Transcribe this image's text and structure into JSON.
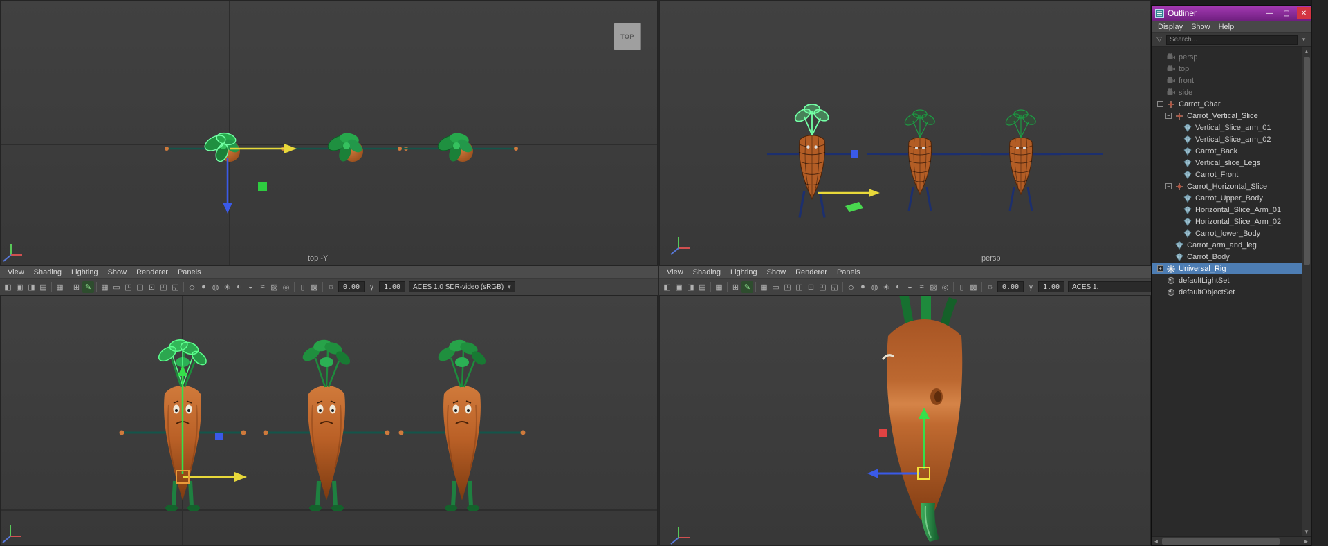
{
  "window": {
    "title": "Outliner",
    "controls": {
      "minimize": "—",
      "maximize": "▢",
      "close": "✕"
    }
  },
  "glyphs": {
    "dropdown": "▾",
    "scroll_up": "▲",
    "scroll_down": "▼",
    "scroll_left": "◄",
    "scroll_right": "►",
    "filter": "▽",
    "expander_minus": "−",
    "expander_plus": "+"
  },
  "outliner": {
    "menu": [
      "Display",
      "Show",
      "Help"
    ],
    "search_placeholder": "Search...",
    "items": [
      {
        "label": "persp",
        "depth": 0,
        "type": "camera",
        "muted": true
      },
      {
        "label": "top",
        "depth": 0,
        "type": "camera",
        "muted": true
      },
      {
        "label": "front",
        "depth": 0,
        "type": "camera",
        "muted": true
      },
      {
        "label": "side",
        "depth": 0,
        "type": "camera",
        "muted": true
      },
      {
        "label": "Carrot_Char",
        "depth": 0,
        "type": "transform",
        "expander": "minus"
      },
      {
        "label": "Carrot_Vertical_Slice",
        "depth": 1,
        "type": "transform",
        "expander": "minus"
      },
      {
        "label": "Vertical_Slice_arm_01",
        "depth": 2,
        "type": "mesh"
      },
      {
        "label": "Vertical_Slice_arm_02",
        "depth": 2,
        "type": "mesh"
      },
      {
        "label": "Carrot_Back",
        "depth": 2,
        "type": "mesh"
      },
      {
        "label": "Vertical_slice_Legs",
        "depth": 2,
        "type": "mesh"
      },
      {
        "label": "Carrot_Front",
        "depth": 2,
        "type": "mesh"
      },
      {
        "label": "Carrot_Horizontal_Slice",
        "depth": 1,
        "type": "transform",
        "expander": "minus"
      },
      {
        "label": "Carrot_Upper_Body",
        "depth": 2,
        "type": "mesh"
      },
      {
        "label": "Horizontal_Slice_Arm_01",
        "depth": 2,
        "type": "mesh"
      },
      {
        "label": "Horizontal_Slice_Arm_02",
        "depth": 2,
        "type": "mesh"
      },
      {
        "label": "Carrot_lower_Body",
        "depth": 2,
        "type": "mesh"
      },
      {
        "label": "Carrot_arm_and_leg",
        "depth": 1,
        "type": "mesh"
      },
      {
        "label": "Carrot_Body",
        "depth": 1,
        "type": "mesh"
      },
      {
        "label": "Universal_Rig",
        "depth": 0,
        "type": "rig",
        "expander": "plus",
        "selected": true
      },
      {
        "label": "defaultLightSet",
        "depth": 0,
        "type": "set"
      },
      {
        "label": "defaultObjectSet",
        "depth": 0,
        "type": "set"
      }
    ]
  },
  "viewports": {
    "top_left": {
      "label": "top -Y",
      "gizmo_label": "TOP"
    },
    "top_right": {
      "label": "persp"
    }
  },
  "panel_menu": [
    "View",
    "Shading",
    "Lighting",
    "Show",
    "Renderer",
    "Panels"
  ],
  "panel_toolbar": {
    "exposure_value": "0.00",
    "gamma_value": "1.00",
    "colorspace_left": "ACES 1.0 SDR-video (sRGB)",
    "colorspace_right": "ACES 1.",
    "icons": [
      {
        "name": "select-camera-icon",
        "glyph": "◧"
      },
      {
        "name": "lock-camera-icon",
        "glyph": "▣"
      },
      {
        "name": "camera-attributes-icon",
        "glyph": "◨"
      },
      {
        "name": "bookmark-icon",
        "glyph": "▤"
      },
      {
        "sep": true
      },
      {
        "name": "image-plane-icon",
        "glyph": "▦"
      },
      {
        "sep": true
      },
      {
        "name": "two-d-pan-zoom-icon",
        "glyph": "⊞"
      },
      {
        "name": "grease-pencil-icon",
        "glyph": "✎",
        "active": true
      },
      {
        "sep": true
      },
      {
        "name": "grid-icon",
        "glyph": "▦"
      },
      {
        "name": "film-gate-icon",
        "glyph": "▭"
      },
      {
        "name": "resolution-gate-icon",
        "glyph": "◳"
      },
      {
        "name": "gate-mask-icon",
        "glyph": "◫"
      },
      {
        "name": "field-chart-icon",
        "glyph": "⊡"
      },
      {
        "name": "safe-action-icon",
        "glyph": "◰"
      },
      {
        "name": "safe-title-icon",
        "glyph": "◱"
      },
      {
        "sep": true
      },
      {
        "name": "wireframe-icon",
        "glyph": "◇"
      },
      {
        "name": "smooth-shade-icon",
        "glyph": "●"
      },
      {
        "name": "textured-icon",
        "glyph": "◍"
      },
      {
        "name": "use-all-lights-icon",
        "glyph": "☀"
      },
      {
        "name": "shadows-icon",
        "glyph": "◐"
      },
      {
        "name": "screen-space-ao-icon",
        "glyph": "◒"
      },
      {
        "name": "motion-blur-icon",
        "glyph": "≈"
      },
      {
        "name": "multisample-icon",
        "glyph": "▨"
      },
      {
        "name": "depth-of-field-icon",
        "glyph": "◎"
      },
      {
        "sep": true
      },
      {
        "name": "isolate-select-icon",
        "glyph": "▯"
      },
      {
        "name": "x-ray-icon",
        "glyph": "▩"
      },
      {
        "sep": true
      },
      {
        "name": "exposure-icon",
        "glyph": "☼"
      },
      {
        "field": "exposure_value",
        "name": "exposure-field"
      },
      {
        "name": "gamma-icon",
        "glyph": "γ"
      },
      {
        "field": "gamma_value",
        "name": "gamma-field"
      },
      {
        "colorspace": true,
        "name": "colorspace-dropdown"
      }
    ]
  },
  "colors": {
    "selection_blue": "#4d7db3",
    "titlebar_purple": "#a53ab4",
    "viewport_bg": "#3b3b3b",
    "manipulator_yellow": "#e8d83a",
    "manipulator_green": "#35e04a",
    "manipulator_blue": "#3a5ae8",
    "manipulator_red": "#e04343"
  }
}
